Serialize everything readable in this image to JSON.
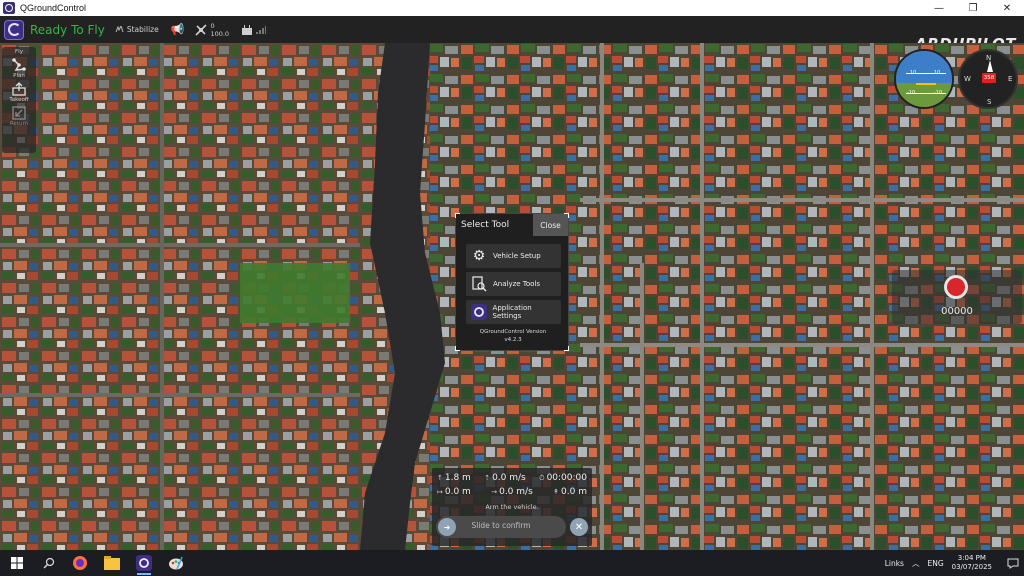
{
  "window": {
    "title": "QGroundControl",
    "minimize": "—",
    "maximize": "❐",
    "close": "✕"
  },
  "toolbar": {
    "status": "Ready To Fly",
    "flight_mode": "Stabilize",
    "gps_count": "0",
    "gps_hdop": "100.0",
    "brand": "ARDUPILOT"
  },
  "left_tools": [
    {
      "label": "Fly",
      "icon": "fly-icon",
      "dim": false
    },
    {
      "label": "Plan",
      "icon": "plan-icon",
      "dim": false
    },
    {
      "label": "Takeoff",
      "icon": "takeoff-icon",
      "dim": false
    },
    {
      "label": "Return",
      "icon": "return-icon",
      "dim": true
    }
  ],
  "attitude": {
    "pitch_up": "10",
    "pitch_down": "-10",
    "pitch_up2": "10",
    "pitch_down2": "-10"
  },
  "compass": {
    "north": "N",
    "south": "S",
    "east": "E",
    "west": "W",
    "heading": "358"
  },
  "camera": {
    "count": "00000"
  },
  "tool_dialog": {
    "title": "Select Tool",
    "close": "Close",
    "buttons": [
      {
        "label": "Vehicle Setup",
        "icon": "gears-icon"
      },
      {
        "label": "Analyze Tools",
        "icon": "analyze-icon"
      },
      {
        "label": "Application Settings",
        "icon": "qgc-logo-icon"
      }
    ],
    "version_label": "QGroundControl Version",
    "version": "v4.2.3"
  },
  "telemetry": {
    "altitude": "1.8 m",
    "vertical_speed": "0.0 m/s",
    "flight_time": "00:00:00",
    "distance": "0.0 m",
    "horizontal_speed": "0.0 m/s",
    "distance_home": "0.0 m",
    "arm_hint": "Arm the vehicle.",
    "slider_label": "Slide to confirm"
  },
  "taskbar": {
    "links": "Links",
    "lang": "ENG",
    "time": "3:04 PM",
    "date": "03/07/2025"
  },
  "colors": {
    "ready": "#37b24d",
    "toolbar_bg": "#222222",
    "record_red": "#d9262b",
    "sky": "#3d7ec9",
    "ground": "#6b9a3c"
  }
}
